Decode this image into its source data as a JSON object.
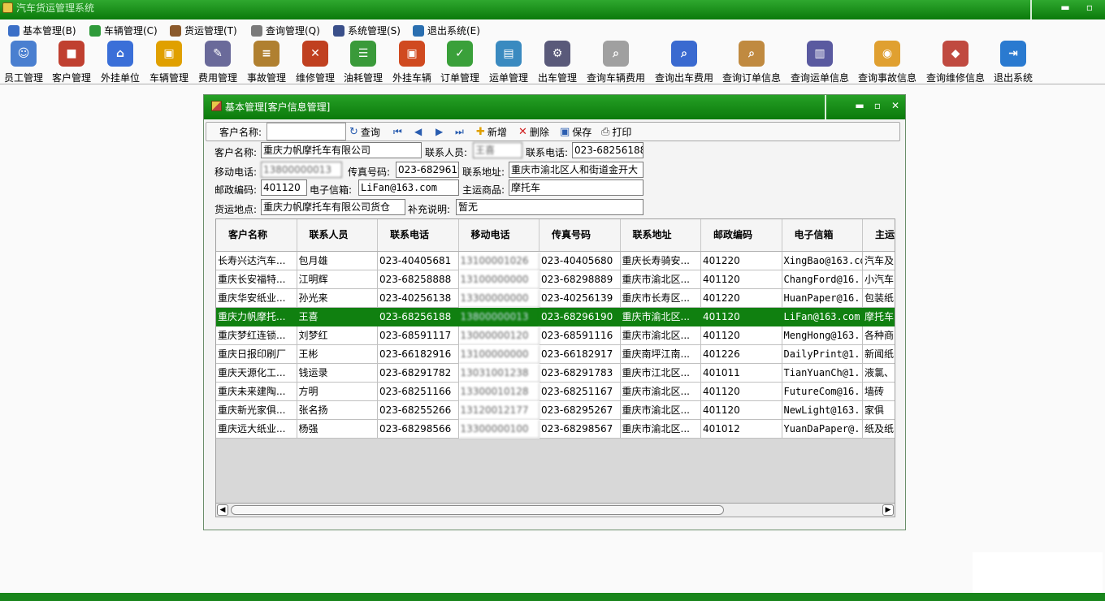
{
  "app": {
    "title": "汽车货运管理系统"
  },
  "window_controls": {
    "minimize": "▬",
    "restore": "▫",
    "close": "✕"
  },
  "menu": [
    {
      "label": "基本管理(B)",
      "color": "#3b6fc7"
    },
    {
      "label": "车辆管理(C)",
      "color": "#2f9a3a"
    },
    {
      "label": "货运管理(T)",
      "color": "#8b5a2b"
    },
    {
      "label": "查询管理(Q)",
      "color": "#7a7a7a"
    },
    {
      "label": "系统管理(S)",
      "color": "#3a4f8a"
    },
    {
      "label": "退出系统(E)",
      "color": "#2a6fb0"
    }
  ],
  "toolbar": [
    {
      "label": "员工管理",
      "icon": "people-icon",
      "color": "#4a7fd0"
    },
    {
      "label": "客户管理",
      "icon": "cube-icon",
      "color": "#c04030"
    },
    {
      "label": "外挂单位",
      "icon": "house-icon",
      "color": "#3a6fd8"
    },
    {
      "label": "车辆管理",
      "icon": "truck-icon",
      "color": "#e0a000"
    },
    {
      "label": "费用管理",
      "icon": "notebook-icon",
      "color": "#6a6a9a"
    },
    {
      "label": "事故管理",
      "icon": "document-icon",
      "color": "#b08030"
    },
    {
      "label": "维修管理",
      "icon": "tools-icon",
      "color": "#c04020"
    },
    {
      "label": "油耗管理",
      "icon": "meter-icon",
      "color": "#3a9a3a"
    },
    {
      "label": "外挂车辆",
      "icon": "truck-icon",
      "color": "#d04a20"
    },
    {
      "label": "订单管理",
      "icon": "checklist-icon",
      "color": "#3aa03a"
    },
    {
      "label": "运单管理",
      "icon": "box-icon",
      "color": "#3a8ac0"
    },
    {
      "label": "出车管理",
      "icon": "gear-icon",
      "color": "#5a5a7a"
    },
    {
      "label": "查询车辆费用",
      "icon": "magnifier-icon",
      "color": "#a0a0a0"
    },
    {
      "label": "查询出车费用",
      "icon": "person-search-icon",
      "color": "#3a6ad0"
    },
    {
      "label": "查询订单信息",
      "icon": "magnifier-icon",
      "color": "#c08a40"
    },
    {
      "label": "查询运单信息",
      "icon": "server-icon",
      "color": "#5a5aa0"
    },
    {
      "label": "查询事故信息",
      "icon": "globe-icon",
      "color": "#e0a030"
    },
    {
      "label": "查询维修信息",
      "icon": "package-icon",
      "color": "#c04a40"
    },
    {
      "label": "退出系统",
      "icon": "exit-icon",
      "color": "#2a7ad0"
    }
  ],
  "child": {
    "title": "基本管理[客户信息管理]",
    "search": {
      "label": "客户名称:",
      "value": "",
      "query": "查询",
      "add": "新增",
      "delete": "删除",
      "save": "保存",
      "print": "打印"
    },
    "form": {
      "name_label": "客户名称:",
      "name": "重庆力帆摩托车有限公司",
      "contact_label": "联系人员:",
      "contact": "王喜",
      "phone_label": "联系电话:",
      "phone": "023-68256188",
      "mobile_label": "移动电话:",
      "mobile": "13800000013",
      "fax_label": "传真号码:",
      "fax": "023-68296190",
      "addr_label": "联系地址:",
      "addr": "重庆市渝北区人和街道金开大",
      "zip_label": "邮政编码:",
      "zip": "401120",
      "email_label": "电子信箱:",
      "email": "LiFan@163.com",
      "goods_label": "主运商品:",
      "goods": "摩托车",
      "place_label": "货运地点:",
      "place": "重庆力帆摩托车有限公司货仓",
      "note_label": "补充说明:",
      "note": "暂无"
    },
    "grid": {
      "columns": [
        "客户名称",
        "联系人员",
        "联系电话",
        "移动电话",
        "传真号码",
        "联系地址",
        "邮政编码",
        "电子信箱",
        "主运"
      ],
      "rows": [
        [
          "长寿兴达汽车...",
          "包月雄",
          "023-40405681",
          "13100001026",
          "023-40405680",
          "重庆长寿骑安...",
          "401220",
          "XingBao@163.com",
          "汽车及"
        ],
        [
          "重庆长安福特...",
          "江明辉",
          "023-68258888",
          "13100000000",
          "023-68298889",
          "重庆市渝北区...",
          "401120",
          "ChangFord@16...",
          "小汽车"
        ],
        [
          "重庆华安纸业...",
          "孙光来",
          "023-40256138",
          "13300000000",
          "023-40256139",
          "重庆市长寿区...",
          "401220",
          "HuanPaper@16...",
          "包装纸"
        ],
        [
          "重庆力帆摩托...",
          "王喜",
          "023-68256188",
          "13800000013",
          "023-68296190",
          "重庆市渝北区...",
          "401120",
          "LiFan@163.com",
          "摩托车"
        ],
        [
          "重庆梦红连锁...",
          "刘梦红",
          "023-68591117",
          "13000000120",
          "023-68591116",
          "重庆市渝北区...",
          "401120",
          "MengHong@163...",
          "各种商"
        ],
        [
          "重庆日报印刷厂",
          "王彬",
          "023-66182916",
          "13100000000",
          "023-66182917",
          "重庆南坪江南...",
          "401226",
          "DailyPrint@1...",
          "新闻纸"
        ],
        [
          "重庆天源化工...",
          "钱运录",
          "023-68291782",
          "13031001238",
          "023-68291783",
          "重庆市江北区...",
          "401011",
          "TianYuanCh@1...",
          "液氯、"
        ],
        [
          "重庆未来建陶...",
          "方明",
          "023-68251166",
          "13300010128",
          "023-68251167",
          "重庆市渝北区...",
          "401120",
          "FutureCom@16...",
          "墙砖"
        ],
        [
          "重庆新光家俱...",
          "张名扬",
          "023-68255266",
          "13120012177",
          "023-68295267",
          "重庆市渝北区...",
          "401120",
          "NewLight@163...",
          "家俱"
        ],
        [
          "重庆远大纸业...",
          "杨强",
          "023-68298566",
          "13300000100",
          "023-68298567",
          "重庆市渝北区...",
          "401012",
          "YuanDaPaper@...",
          "纸及纸"
        ]
      ],
      "selected_index": 3
    }
  }
}
